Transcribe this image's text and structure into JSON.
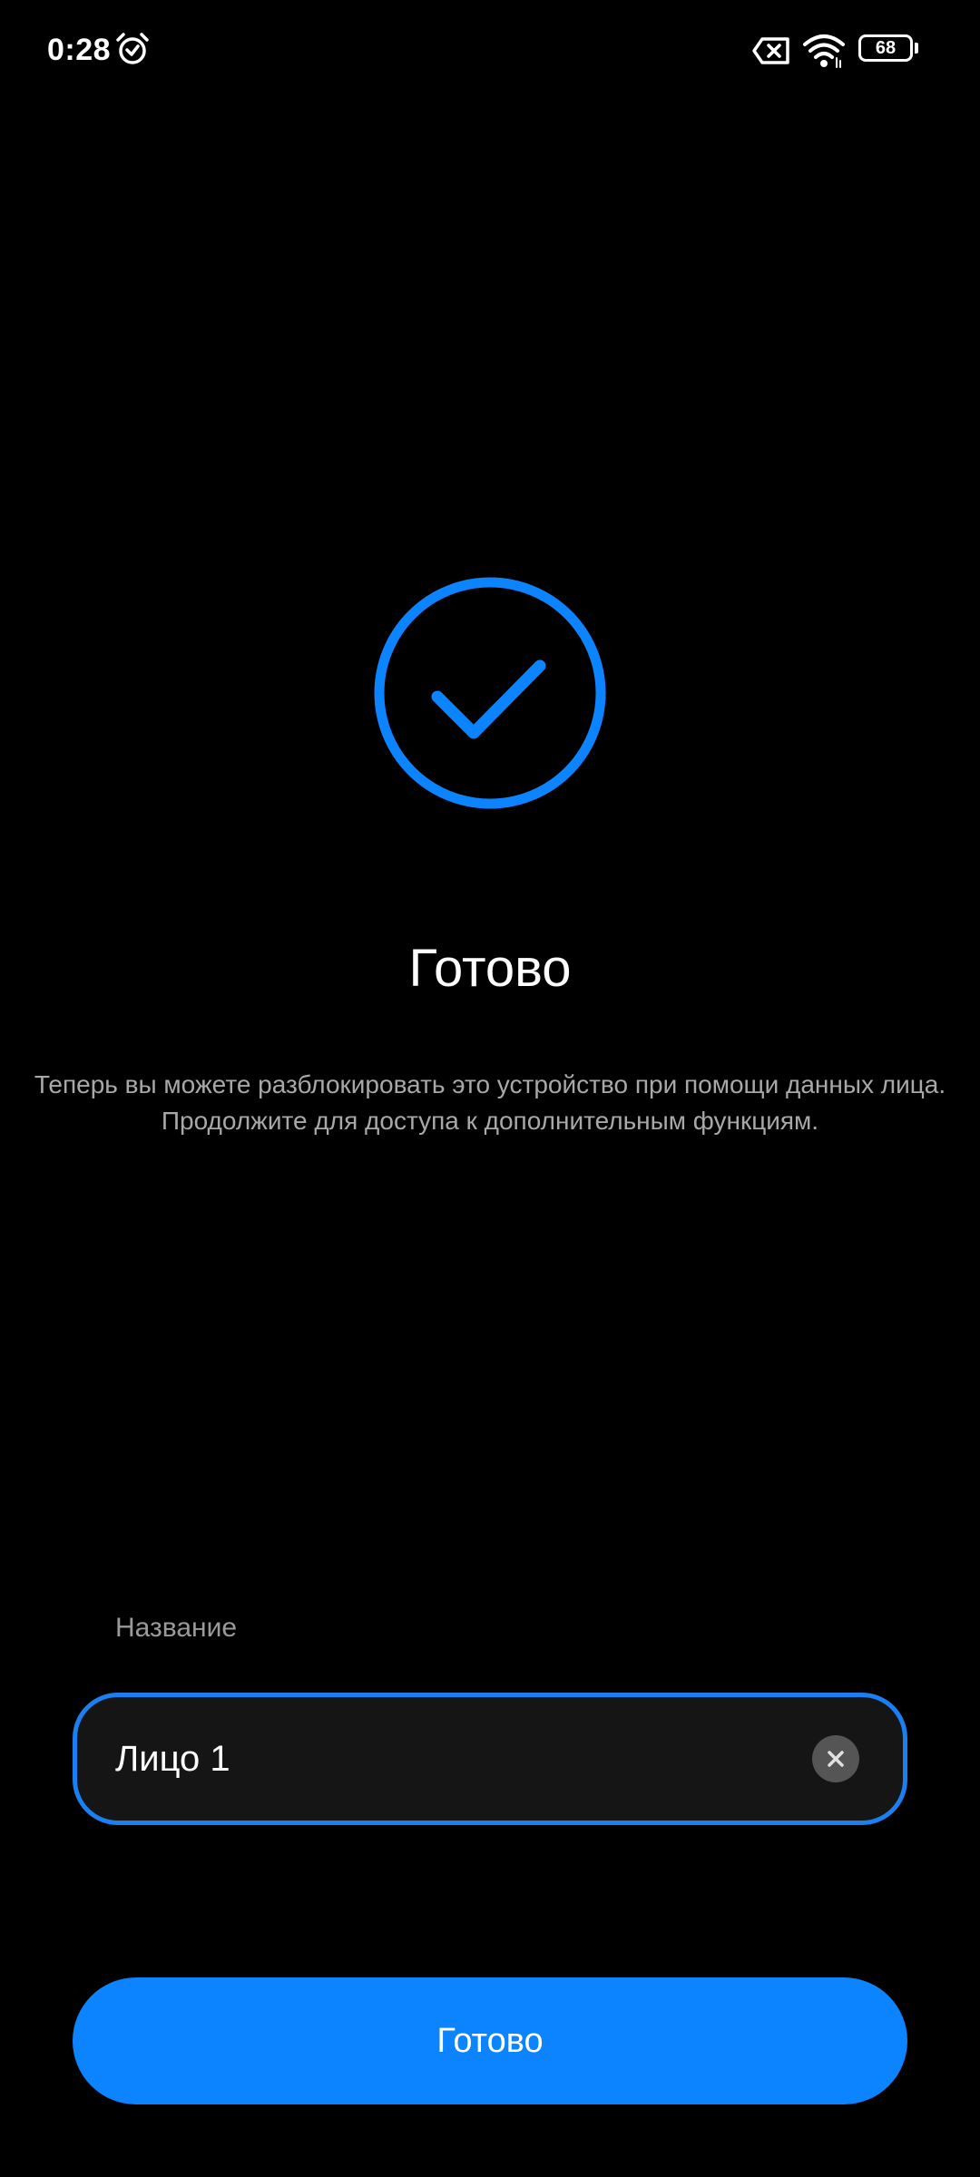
{
  "status_bar": {
    "time": "0:28",
    "battery_level": "68",
    "icons": [
      "alarm-clock-icon",
      "no-sim-icon",
      "wifi-icon",
      "battery-icon"
    ]
  },
  "main": {
    "icon": "checkmark-circle-icon",
    "accent_color": "#0d84ff",
    "title": "Готово",
    "description_lines": [
      "Теперь вы можете разблокировать это устройство при помощи данных лица.",
      "Продолжите для доступа к дополнительным функциям."
    ]
  },
  "name_field": {
    "label": "Название",
    "value": "Лицо 1",
    "clear_icon": "clear-icon"
  },
  "done_button": {
    "label": "Готово"
  }
}
